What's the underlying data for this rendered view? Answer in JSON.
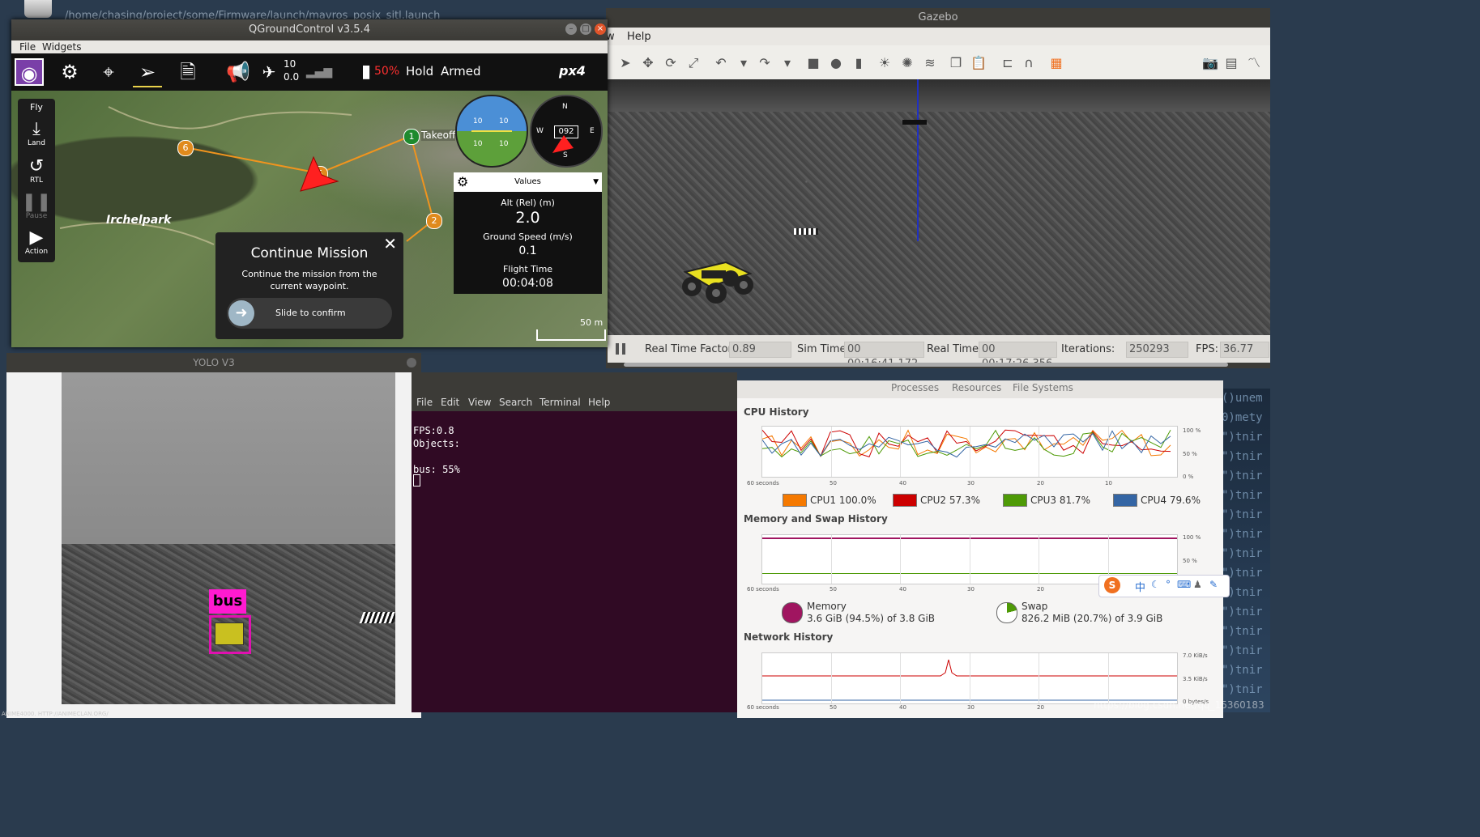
{
  "desktop": {
    "launch_path": "/home/chasing/project/some/Firmware/launch/mavros_posix_sitl.launch",
    "watermark": "ANIME4000. HTTP://ANIMECLAN.ORG/",
    "csdn_watermark": "https://blog.csdn.net/qq_15360183",
    "bg_code": [
      "()unem",
      "0)mety",
      "\")tnir",
      "\")tnir",
      "\")tnir",
      "\")tnir",
      "\")tnir",
      "\")tnir",
      "\")tnir",
      "\")tnir",
      "\")tnir",
      "\")tnir",
      "\")tnir",
      "\")tnir",
      "\")tnir",
      "\")tnir"
    ]
  },
  "gazebo": {
    "title": "Gazebo",
    "menu": [
      "w",
      "Help"
    ],
    "status": {
      "rtf_label": "Real Time Factor:",
      "rtf": "0.89",
      "sim_label": "Sim Time:",
      "sim": "00 00:16:41.172",
      "real_label": "Real Time:",
      "real": "00 00:17:26.356",
      "iter_label": "Iterations:",
      "iter": "250293",
      "fps_label": "FPS:",
      "fps": "36.77"
    },
    "tools": [
      "select-arrow-icon",
      "translate-icon",
      "rotate-icon",
      "scale-icon",
      "undo-icon",
      "chevron-down-icon",
      "redo-icon",
      "chevron-down-icon",
      "box-icon",
      "sphere-icon",
      "cylinder-icon",
      "sun-icon",
      "point-light-icon",
      "directional-light-icon",
      "copy-icon",
      "paste-icon",
      "align-icon",
      "magnet-icon",
      "snap-icon",
      "camera-icon",
      "log-icon",
      "plot-icon"
    ]
  },
  "qgc": {
    "title": "QGroundControl v3.5.4",
    "menu": {
      "file": "File",
      "widgets": "Widgets"
    },
    "toolbar": {
      "sat_count": "10",
      "hdop": "0.0",
      "battery": "50%",
      "mode": "Hold",
      "armed": "Armed",
      "logo": "px4"
    },
    "flyrail": {
      "header": "Fly",
      "land": "Land",
      "rtl": "RTL",
      "pause": "Pause",
      "action": "Action"
    },
    "map": {
      "park_label": "Irchelpark",
      "waypoints": [
        {
          "num": "1",
          "label": "Takeoff"
        },
        {
          "num": "2"
        },
        {
          "num": "5"
        },
        {
          "num": "6"
        }
      ],
      "scale": "50 m"
    },
    "dialog": {
      "title": "Continue Mission",
      "text": "Continue the mission from the current waypoint.",
      "slide": "Slide to confirm"
    },
    "attitude": {
      "pitch_up": "10",
      "pitch_down": "10"
    },
    "compass": {
      "heading": "092",
      "n": "N",
      "e": "E",
      "s": "S",
      "w": "W"
    },
    "values": {
      "header": "Values",
      "alt_label": "Alt (Rel) (m)",
      "alt": "2.0",
      "gs_label": "Ground Speed (m/s)",
      "gs": "0.1",
      "ft_label": "Flight Time",
      "ft": "00:04:08"
    }
  },
  "yolo": {
    "title": "YOLO V3",
    "detection_label": "bus"
  },
  "terminal": {
    "menu": [
      "File",
      "Edit",
      "View",
      "Search",
      "Terminal",
      "Help"
    ],
    "lines": "FPS:0.8\nObjects:\n\nbus: 55%"
  },
  "sysmon": {
    "tabs": [
      "Processes",
      "Resources",
      "File Systems"
    ],
    "cpu_title": "CPU History",
    "mem_title": "Memory and Swap History",
    "net_title": "Network History",
    "x_ticks": [
      "60 seconds",
      "50",
      "40",
      "30",
      "20",
      "10",
      "0"
    ],
    "cpu_y": [
      "100 %",
      "50 %",
      "0 %"
    ],
    "mem_y": [
      "100 %",
      "50 %"
    ],
    "net_y": [
      "7.0 KiB/s",
      "3.5 KiB/s",
      "0 bytes/s"
    ],
    "cpus": [
      {
        "label": "CPU1 100.0%",
        "color": "#f57900"
      },
      {
        "label": "CPU2 57.3%",
        "color": "#cc0000"
      },
      {
        "label": "CPU3 81.7%",
        "color": "#4e9a06"
      },
      {
        "label": "CPU4 79.6%",
        "color": "#3465a4"
      }
    ],
    "memory": {
      "label": "Memory",
      "detail": "3.6 GiB (94.5%) of 3.8 GiB",
      "color": "#a01560"
    },
    "swap": {
      "label": "Swap",
      "detail": "826.2 MiB (20.7%) of 3.9 GiB",
      "color": "#4e9a06"
    }
  },
  "ime": {
    "logo": "S",
    "mode": "中"
  }
}
